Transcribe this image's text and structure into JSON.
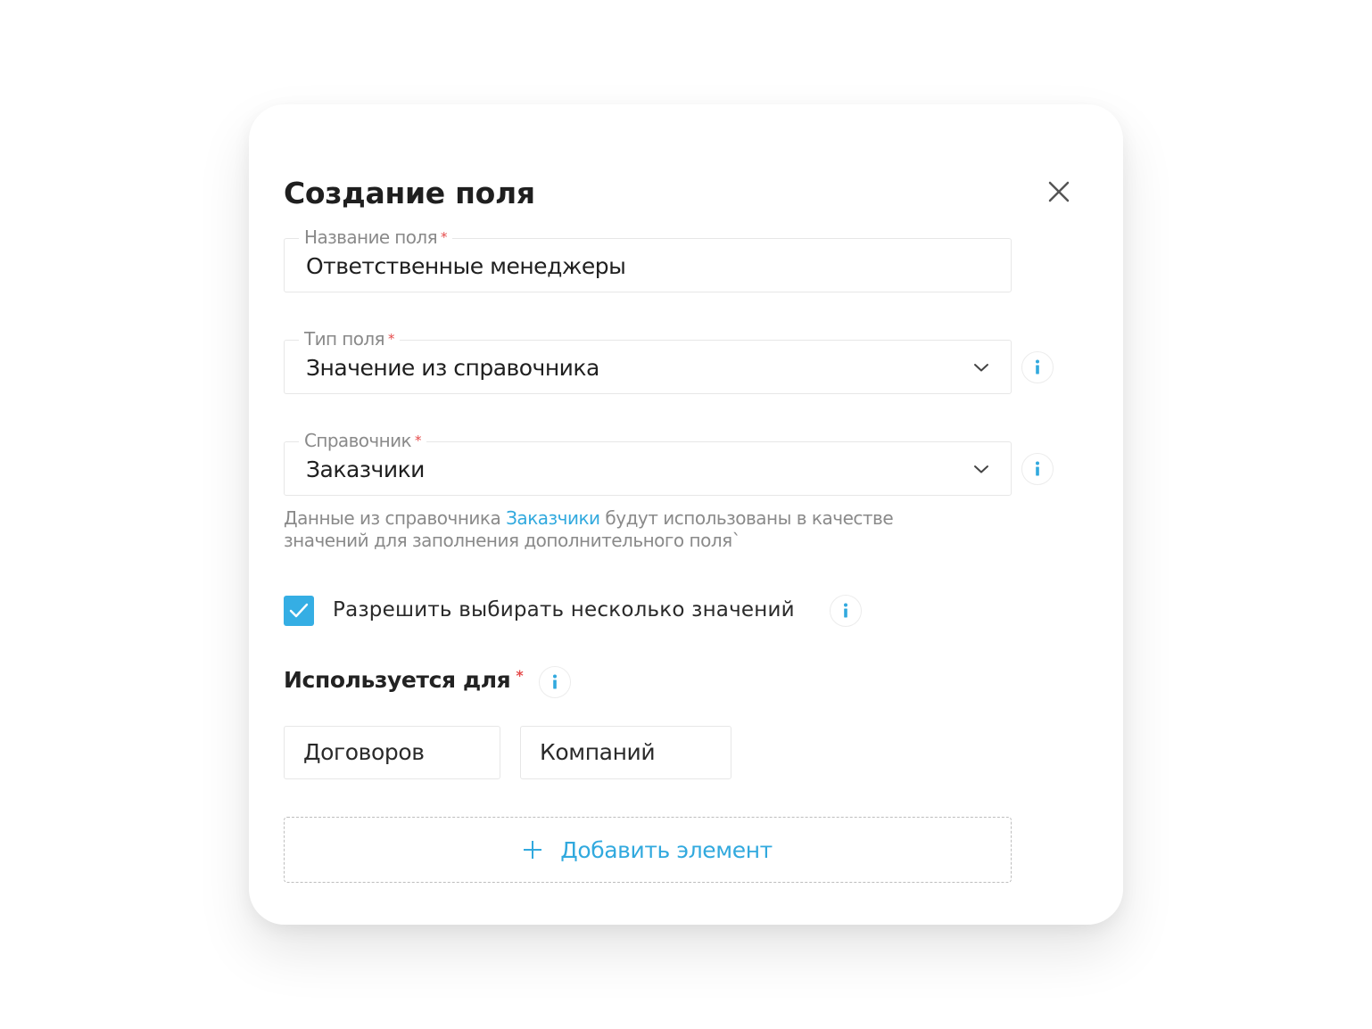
{
  "dialog": {
    "title": "Создание поля",
    "close_icon": "close-icon"
  },
  "fields": {
    "name": {
      "label": "Название поля",
      "required_mark": "*",
      "value": "Ответственные менеджеры"
    },
    "type": {
      "label": "Тип поля",
      "required_mark": "*",
      "value": "Значение из справочника",
      "icon": "chevron-down-icon"
    },
    "directory": {
      "label": "Справочник",
      "required_mark": "*",
      "value": "Заказчики",
      "icon": "chevron-down-icon"
    }
  },
  "hint": {
    "before": "Данные из справочника ",
    "link": "Заказчики",
    "after": " будут использованы в качестве значений для заполнения дополнительного поля`"
  },
  "multi_select": {
    "checked": true,
    "label": "Разрешить выбирать несколько значений"
  },
  "used_for": {
    "title": "Используется для",
    "required_mark": "*",
    "chips": [
      "Договоров",
      "Компаний"
    ]
  },
  "add_element": {
    "label": "Добавить элемент",
    "icon": "plus-icon"
  },
  "info_icon": "info-icon",
  "colors": {
    "accent": "#35aee4",
    "link": "#31a9de",
    "required": "#e54b4b",
    "border": "#e7e7e7",
    "muted_text": "#8a8a8a"
  }
}
